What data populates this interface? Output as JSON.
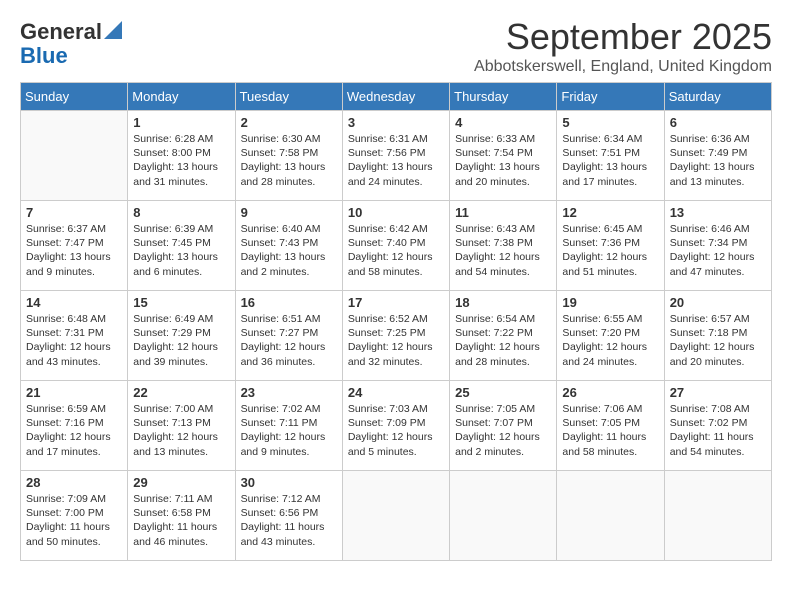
{
  "logo": {
    "general": "General",
    "blue": "Blue"
  },
  "header": {
    "month": "September 2025",
    "location": "Abbotskerswell, England, United Kingdom"
  },
  "days_of_week": [
    "Sunday",
    "Monday",
    "Tuesday",
    "Wednesday",
    "Thursday",
    "Friday",
    "Saturday"
  ],
  "weeks": [
    [
      {
        "day": "",
        "info": ""
      },
      {
        "day": "1",
        "info": "Sunrise: 6:28 AM\nSunset: 8:00 PM\nDaylight: 13 hours\nand 31 minutes."
      },
      {
        "day": "2",
        "info": "Sunrise: 6:30 AM\nSunset: 7:58 PM\nDaylight: 13 hours\nand 28 minutes."
      },
      {
        "day": "3",
        "info": "Sunrise: 6:31 AM\nSunset: 7:56 PM\nDaylight: 13 hours\nand 24 minutes."
      },
      {
        "day": "4",
        "info": "Sunrise: 6:33 AM\nSunset: 7:54 PM\nDaylight: 13 hours\nand 20 minutes."
      },
      {
        "day": "5",
        "info": "Sunrise: 6:34 AM\nSunset: 7:51 PM\nDaylight: 13 hours\nand 17 minutes."
      },
      {
        "day": "6",
        "info": "Sunrise: 6:36 AM\nSunset: 7:49 PM\nDaylight: 13 hours\nand 13 minutes."
      }
    ],
    [
      {
        "day": "7",
        "info": "Sunrise: 6:37 AM\nSunset: 7:47 PM\nDaylight: 13 hours\nand 9 minutes."
      },
      {
        "day": "8",
        "info": "Sunrise: 6:39 AM\nSunset: 7:45 PM\nDaylight: 13 hours\nand 6 minutes."
      },
      {
        "day": "9",
        "info": "Sunrise: 6:40 AM\nSunset: 7:43 PM\nDaylight: 13 hours\nand 2 minutes."
      },
      {
        "day": "10",
        "info": "Sunrise: 6:42 AM\nSunset: 7:40 PM\nDaylight: 12 hours\nand 58 minutes."
      },
      {
        "day": "11",
        "info": "Sunrise: 6:43 AM\nSunset: 7:38 PM\nDaylight: 12 hours\nand 54 minutes."
      },
      {
        "day": "12",
        "info": "Sunrise: 6:45 AM\nSunset: 7:36 PM\nDaylight: 12 hours\nand 51 minutes."
      },
      {
        "day": "13",
        "info": "Sunrise: 6:46 AM\nSunset: 7:34 PM\nDaylight: 12 hours\nand 47 minutes."
      }
    ],
    [
      {
        "day": "14",
        "info": "Sunrise: 6:48 AM\nSunset: 7:31 PM\nDaylight: 12 hours\nand 43 minutes."
      },
      {
        "day": "15",
        "info": "Sunrise: 6:49 AM\nSunset: 7:29 PM\nDaylight: 12 hours\nand 39 minutes."
      },
      {
        "day": "16",
        "info": "Sunrise: 6:51 AM\nSunset: 7:27 PM\nDaylight: 12 hours\nand 36 minutes."
      },
      {
        "day": "17",
        "info": "Sunrise: 6:52 AM\nSunset: 7:25 PM\nDaylight: 12 hours\nand 32 minutes."
      },
      {
        "day": "18",
        "info": "Sunrise: 6:54 AM\nSunset: 7:22 PM\nDaylight: 12 hours\nand 28 minutes."
      },
      {
        "day": "19",
        "info": "Sunrise: 6:55 AM\nSunset: 7:20 PM\nDaylight: 12 hours\nand 24 minutes."
      },
      {
        "day": "20",
        "info": "Sunrise: 6:57 AM\nSunset: 7:18 PM\nDaylight: 12 hours\nand 20 minutes."
      }
    ],
    [
      {
        "day": "21",
        "info": "Sunrise: 6:59 AM\nSunset: 7:16 PM\nDaylight: 12 hours\nand 17 minutes."
      },
      {
        "day": "22",
        "info": "Sunrise: 7:00 AM\nSunset: 7:13 PM\nDaylight: 12 hours\nand 13 minutes."
      },
      {
        "day": "23",
        "info": "Sunrise: 7:02 AM\nSunset: 7:11 PM\nDaylight: 12 hours\nand 9 minutes."
      },
      {
        "day": "24",
        "info": "Sunrise: 7:03 AM\nSunset: 7:09 PM\nDaylight: 12 hours\nand 5 minutes."
      },
      {
        "day": "25",
        "info": "Sunrise: 7:05 AM\nSunset: 7:07 PM\nDaylight: 12 hours\nand 2 minutes."
      },
      {
        "day": "26",
        "info": "Sunrise: 7:06 AM\nSunset: 7:05 PM\nDaylight: 11 hours\nand 58 minutes."
      },
      {
        "day": "27",
        "info": "Sunrise: 7:08 AM\nSunset: 7:02 PM\nDaylight: 11 hours\nand 54 minutes."
      }
    ],
    [
      {
        "day": "28",
        "info": "Sunrise: 7:09 AM\nSunset: 7:00 PM\nDaylight: 11 hours\nand 50 minutes."
      },
      {
        "day": "29",
        "info": "Sunrise: 7:11 AM\nSunset: 6:58 PM\nDaylight: 11 hours\nand 46 minutes."
      },
      {
        "day": "30",
        "info": "Sunrise: 7:12 AM\nSunset: 6:56 PM\nDaylight: 11 hours\nand 43 minutes."
      },
      {
        "day": "",
        "info": ""
      },
      {
        "day": "",
        "info": ""
      },
      {
        "day": "",
        "info": ""
      },
      {
        "day": "",
        "info": ""
      }
    ]
  ]
}
